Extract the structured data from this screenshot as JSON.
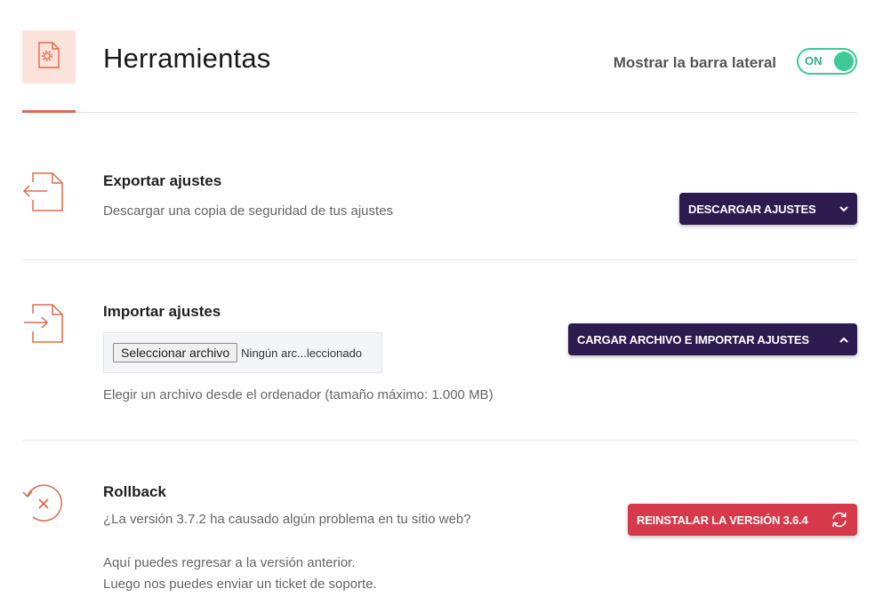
{
  "header": {
    "title": "Herramientas",
    "sidebar_label": "Mostrar la barra lateral",
    "toggle_state": "ON",
    "tab_icon": "document-gear-icon"
  },
  "export": {
    "title": "Exportar ajustes",
    "description": "Descargar una copia de seguridad de tus ajustes",
    "button_label": "DESCARGAR AJUSTES",
    "icon": "export-file-icon"
  },
  "import": {
    "title": "Importar ajustes",
    "file_button_label": "Seleccionar archivo",
    "file_status": "Ningún arc...leccionado",
    "description": "Elegir un archivo desde el ordenador (tamaño máximo: 1.000 MB)",
    "button_label": "CARGAR ARCHIVO E IMPORTAR AJUSTES",
    "icon": "import-file-icon"
  },
  "rollback": {
    "title": "Rollback",
    "description_1": "¿La versión 3.7.2 ha causado algún problema en tu sitio web?",
    "description_2": "Aquí puedes regresar a la versión anterior.",
    "description_3": "Luego nos puedes enviar un ticket de soporte.",
    "button_label": "REINSTALAR LA VERSIÓN 3.6.4",
    "icon": "rollback-icon"
  },
  "colors": {
    "accent": "#e06a4c",
    "accent_bg": "#fbe3dc",
    "toggle_green": "#3ec996",
    "button_dark": "#2d1a4f",
    "button_red": "#d6394a"
  }
}
